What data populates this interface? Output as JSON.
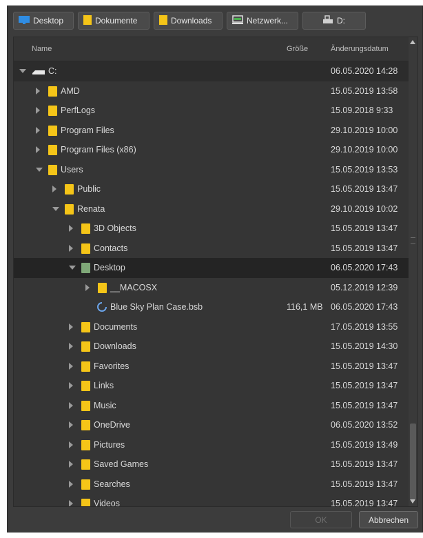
{
  "shortcuts": [
    {
      "label": "Desktop",
      "icon": "desktop-icon"
    },
    {
      "label": "Dokumente",
      "icon": "folder-icon"
    },
    {
      "label": "Downloads",
      "icon": "folder-icon"
    },
    {
      "label": "Netzwerk...",
      "icon": "network-icon"
    },
    {
      "label": "D:",
      "icon": "drive-icon"
    }
  ],
  "columns": {
    "name": "Name",
    "size": "Größe",
    "date": "Änderungsdatum"
  },
  "tree": [
    {
      "name": "C:",
      "date": "06.05.2020 14:28",
      "level": 0,
      "type": "drive",
      "arrow": "expanded"
    },
    {
      "name": "AMD",
      "date": "15.05.2019 13:58",
      "level": 1,
      "type": "folder",
      "arrow": "collapsed"
    },
    {
      "name": "PerfLogs",
      "date": "15.09.2018 9:33",
      "level": 1,
      "type": "folder",
      "arrow": "collapsed"
    },
    {
      "name": "Program Files",
      "date": "29.10.2019 10:00",
      "level": 1,
      "type": "folder",
      "arrow": "collapsed"
    },
    {
      "name": "Program Files (x86)",
      "date": "29.10.2019 10:00",
      "level": 1,
      "type": "folder",
      "arrow": "collapsed"
    },
    {
      "name": "Users",
      "date": "15.05.2019 13:53",
      "level": 1,
      "type": "folder",
      "arrow": "expanded"
    },
    {
      "name": "Public",
      "date": "15.05.2019 13:47",
      "level": 2,
      "type": "folder",
      "arrow": "collapsed"
    },
    {
      "name": "Renata",
      "date": "29.10.2019 10:02",
      "level": 2,
      "type": "folder",
      "arrow": "expanded"
    },
    {
      "name": "3D Objects",
      "date": "15.05.2019 13:47",
      "level": 3,
      "type": "folder",
      "arrow": "collapsed"
    },
    {
      "name": "Contacts",
      "date": "15.05.2019 13:47",
      "level": 3,
      "type": "folder",
      "arrow": "collapsed"
    },
    {
      "name": "Desktop",
      "date": "06.05.2020 17:43",
      "level": 3,
      "type": "folder-green",
      "arrow": "expanded",
      "selected": true
    },
    {
      "name": "__MACOSX",
      "date": "05.12.2019 12:39",
      "level": 4,
      "type": "folder",
      "arrow": "collapsed"
    },
    {
      "name": "Blue Sky Plan Case.bsb",
      "size": "116,1 MB",
      "date": "06.05.2020 17:43",
      "level": 4,
      "type": "file",
      "arrow": "none"
    },
    {
      "name": "Documents",
      "date": "17.05.2019 13:55",
      "level": 3,
      "type": "folder",
      "arrow": "collapsed"
    },
    {
      "name": "Downloads",
      "date": "15.05.2019 14:30",
      "level": 3,
      "type": "folder",
      "arrow": "collapsed"
    },
    {
      "name": "Favorites",
      "date": "15.05.2019 13:47",
      "level": 3,
      "type": "folder",
      "arrow": "collapsed"
    },
    {
      "name": "Links",
      "date": "15.05.2019 13:47",
      "level": 3,
      "type": "folder",
      "arrow": "collapsed"
    },
    {
      "name": "Music",
      "date": "15.05.2019 13:47",
      "level": 3,
      "type": "folder",
      "arrow": "collapsed"
    },
    {
      "name": "OneDrive",
      "date": "06.05.2020 13:52",
      "level": 3,
      "type": "folder",
      "arrow": "collapsed"
    },
    {
      "name": "Pictures",
      "date": "15.05.2019 13:49",
      "level": 3,
      "type": "folder",
      "arrow": "collapsed"
    },
    {
      "name": "Saved Games",
      "date": "15.05.2019 13:47",
      "level": 3,
      "type": "folder",
      "arrow": "collapsed"
    },
    {
      "name": "Searches",
      "date": "15.05.2019 13:47",
      "level": 3,
      "type": "folder",
      "arrow": "collapsed"
    },
    {
      "name": "Videos",
      "date": "15.05.2019 13:47",
      "level": 3,
      "type": "folder",
      "arrow": "collapsed"
    }
  ],
  "buttons": {
    "ok": "OK",
    "cancel": "Abbrechen"
  }
}
